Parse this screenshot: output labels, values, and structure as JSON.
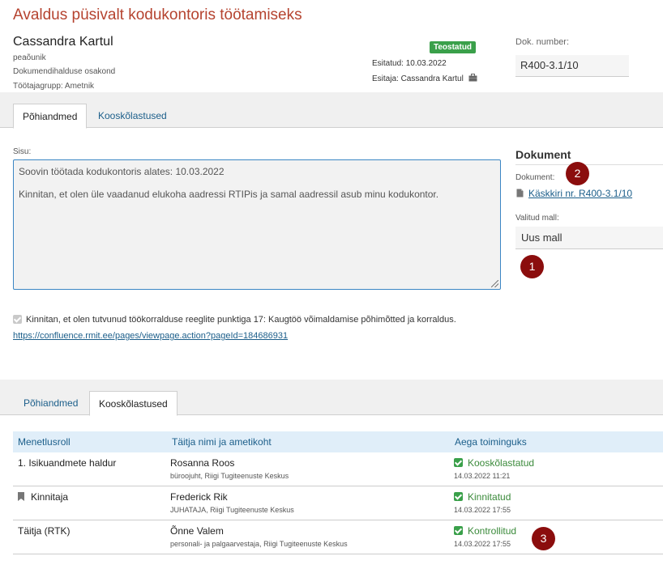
{
  "page_title": "Avaldus püsivalt kodukontoris töötamiseks",
  "person": {
    "name": "Cassandra Kartul",
    "position": "peaõunik",
    "department": "Dokumendihalduse osakond",
    "employee_group": "Töötajagrupp: Ametnik"
  },
  "status": {
    "badge": "Teostatud",
    "badge_color": "#3aa04a",
    "submitted": "Esitatud: 10.03.2022",
    "submitter": "Esitaja: Cassandra Kartul"
  },
  "document_number": {
    "label": "Dok. number:",
    "value": "R400-3.1/10"
  },
  "tabs_top": [
    {
      "label": "Põhiandmed",
      "active": true
    },
    {
      "label": "Kooskõlastused",
      "active": false
    }
  ],
  "content": {
    "label": "Sisu:",
    "line1": "Soovin töötada kodukontoris alates: 10.03.2022",
    "line2": "Kinnitan, et olen üle vaadanud elukoha aadressi RTIPis ja samal aadressil asub minu kodukontor."
  },
  "document_panel": {
    "heading": "Dokument",
    "doc_label": "Dokument:",
    "doc_link": "Käskkiri nr. R400-3.1/10",
    "template_label": "Valitud mall:",
    "template_value": "Uus mall"
  },
  "confirmation": {
    "text": "Kinnitan, et olen tutvunud töökorralduse reeglite punktiga 17: Kaugtöö võimaldamise põhimõtted ja korraldus.",
    "link": "https://confluence.rmit.ee/pages/viewpage.action?pageId=184686931"
  },
  "tabs_bottom": [
    {
      "label": "Põhiandmed",
      "active": false
    },
    {
      "label": "Kooskõlastused",
      "active": true
    }
  ],
  "table": {
    "headers": [
      "Menetlusroll",
      "Täitja nimi ja ametikoht",
      "Aega toiminguks"
    ],
    "rows": [
      {
        "role": "1. Isikuandmete haldur",
        "name": "Rosanna Roos",
        "position": "büroojuht, Riigi Tugiteenuste Keskus",
        "status": "Kooskõlastatud",
        "time": "14.03.2022 11:21"
      },
      {
        "role": "Kinnitaja",
        "name": "Frederick Rik",
        "position": "JUHATAJA, Riigi Tugiteenuste Keskus",
        "status": "Kinnitatud",
        "time": "14.03.2022 17:55"
      },
      {
        "role": "Täitja (RTK)",
        "name": "Õnne Valem",
        "position": "personali- ja palgaarvestaja, Riigi Tugiteenuste Keskus",
        "status": "Kontrollitud",
        "time": "14.03.2022 17:55"
      }
    ]
  },
  "markers": [
    "1",
    "2",
    "3"
  ],
  "colors": {
    "title": "#b5432f",
    "link": "#1b5e8a",
    "marker": "#8b0d0d",
    "status_green": "#3a8a3a"
  }
}
